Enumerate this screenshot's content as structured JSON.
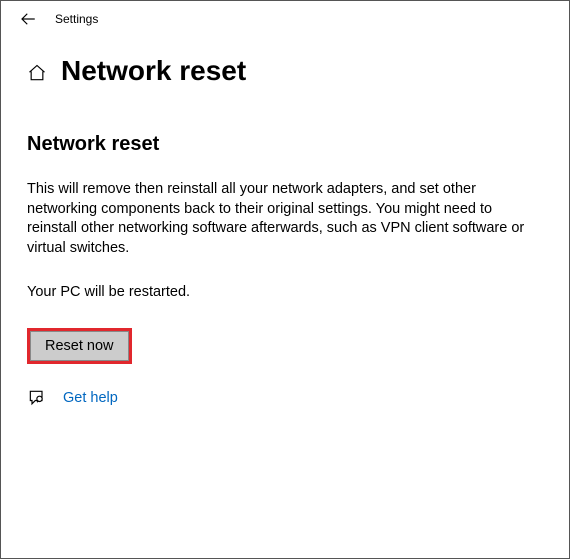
{
  "topbar": {
    "title": "Settings"
  },
  "page": {
    "title": "Network reset"
  },
  "section": {
    "title": "Network reset",
    "description": "This will remove then reinstall all your network adapters, and set other networking components back to their original settings. You might need to reinstall other networking software afterwards, such as VPN client software or virtual switches.",
    "restart_note": "Your PC will be restarted.",
    "reset_button": "Reset now"
  },
  "help": {
    "label": "Get help"
  }
}
